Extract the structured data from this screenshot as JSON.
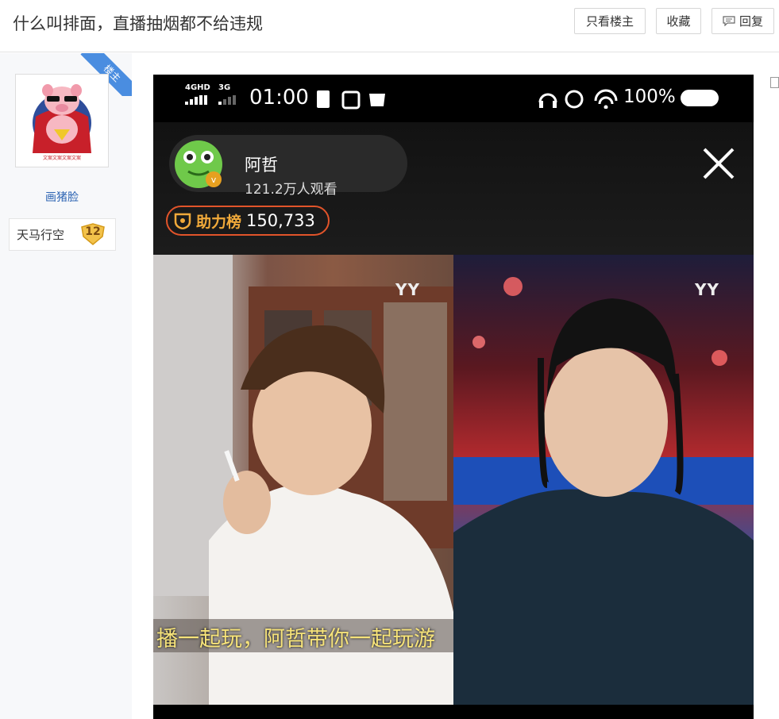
{
  "header": {
    "title": "什么叫排面，直播抽烟都不给违规",
    "buttons": {
      "only_op": "只看楼主",
      "favorite": "收藏",
      "reply": "回复"
    }
  },
  "poster": {
    "op_badge": "楼主",
    "username": "画猪脸",
    "level_name": "天马行空",
    "level": "12"
  },
  "screenshot": {
    "status_bar": {
      "network1": "4GHD",
      "network2": "3G",
      "time": "01:00",
      "battery": "100%"
    },
    "stream": {
      "host_name": "阿哲",
      "viewers": "121.2万人观看",
      "support_label": "助力榜",
      "support_value": "150,733"
    },
    "watermark_left": "YY",
    "watermark_right": "YY",
    "subtitle": "播一起玩，阿哲带你一起玩游"
  },
  "colors": {
    "link": "#2d64b3",
    "op_ribbon": "#4a8de0",
    "support_border": "#e2542a",
    "support_label": "#f0a93a",
    "subtitle": "#f6e37a"
  }
}
